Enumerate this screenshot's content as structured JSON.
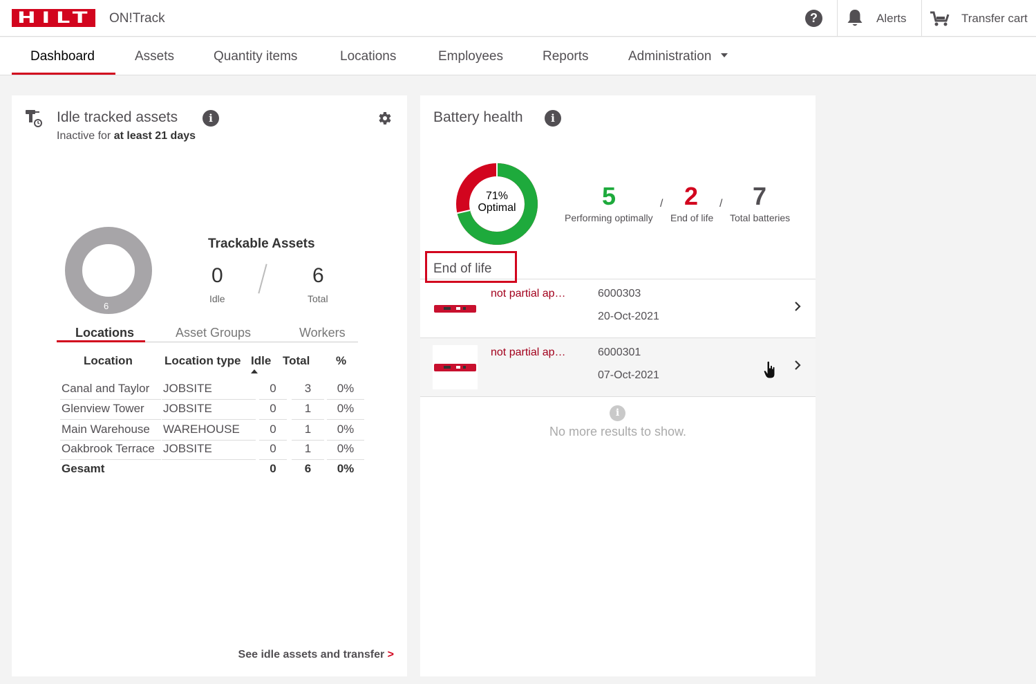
{
  "header": {
    "logo_text": "HILTI",
    "app_name": "ON!Track",
    "help_symbol": "?",
    "alerts_label": "Alerts",
    "transfer_cart_label": "Transfer cart",
    "icons": [
      "help-icon",
      "bell-icon",
      "cart-icon"
    ]
  },
  "nav": {
    "items": [
      {
        "label": "Dashboard",
        "active": true
      },
      {
        "label": "Assets"
      },
      {
        "label": "Quantity items"
      },
      {
        "label": "Locations"
      },
      {
        "label": "Employees"
      },
      {
        "label": "Reports"
      },
      {
        "label": "Administration",
        "has_dropdown": true
      }
    ]
  },
  "idle_card": {
    "title": "Idle tracked assets",
    "subtitle_prefix": "Inactive for",
    "subtitle_bold": "at least 21 days",
    "donut_center_value": "6",
    "trackable_title": "Trackable Assets",
    "idle_value": "0",
    "idle_label": "Idle",
    "total_value": "6",
    "total_label": "Total",
    "tabs": [
      {
        "label": "Locations",
        "active": true
      },
      {
        "label": "Asset Groups"
      },
      {
        "label": "Workers"
      }
    ],
    "table": {
      "headers": [
        "Location",
        "Location type",
        "Idle",
        "Total",
        "%"
      ],
      "rows": [
        [
          "Canal and Taylor",
          "JOBSITE",
          "0",
          "3",
          "0%"
        ],
        [
          "Glenview Tower",
          "JOBSITE",
          "0",
          "1",
          "0%"
        ],
        [
          "Main Warehouse",
          "WAREHOUSE",
          "0",
          "1",
          "0%"
        ],
        [
          "Oakbrook Terrace",
          "JOBSITE",
          "0",
          "1",
          "0%"
        ]
      ],
      "total_row": [
        "Gesamt",
        "",
        "0",
        "6",
        "0%"
      ]
    },
    "see_idle_label": "See idle assets and transfer",
    "see_idle_chevron": ">"
  },
  "battery_card": {
    "title": "Battery health",
    "donut_percent": "71%",
    "donut_label": "Optimal",
    "optimal_fraction": 0.714,
    "colors": {
      "optimal": "#1eaa3c",
      "end_of_life": "#d2051e"
    },
    "stats": [
      {
        "value": "5",
        "label": "Performing optimally",
        "color": "#1eaa3c"
      },
      {
        "value": "2",
        "label": "End of life",
        "color": "#d2051e"
      },
      {
        "value": "7",
        "label": "Total batteries",
        "color": "#524f53"
      }
    ],
    "slash": "/",
    "eol_header": "End of life",
    "eol_items": [
      {
        "name": "not partial ap…",
        "serial": "6000303",
        "date": "20-Oct-2021"
      },
      {
        "name": "not partial ap…",
        "serial": "6000301",
        "date": "07-Oct-2021"
      }
    ],
    "no_more_symbol": "i",
    "no_more_text": "No more results to show."
  }
}
